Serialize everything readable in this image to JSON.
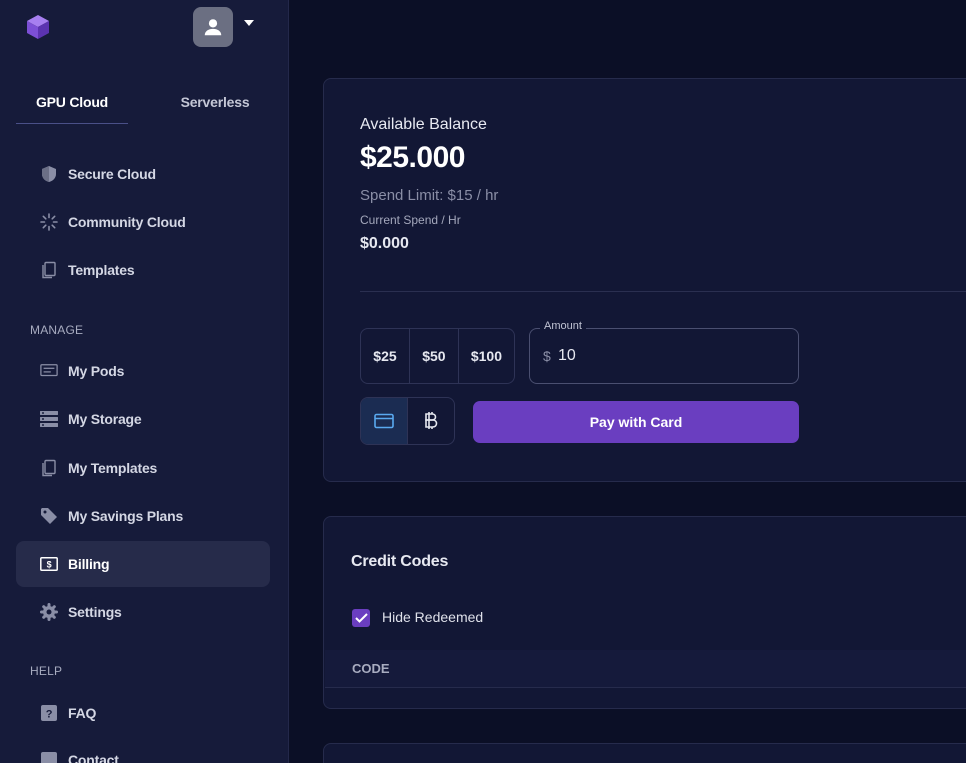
{
  "sidebar": {
    "tabs": [
      "GPU Cloud",
      "Serverless"
    ],
    "cloud_items": [
      "Secure Cloud",
      "Community Cloud",
      "Templates"
    ],
    "manage_title": "MANAGE",
    "manage_items": [
      "My Pods",
      "My Storage",
      "My Templates",
      "My Savings Plans",
      "Billing",
      "Settings"
    ],
    "help_title": "HELP",
    "help_items": [
      "FAQ",
      "Contact"
    ]
  },
  "balance": {
    "label": "Available Balance",
    "value": "$25.000",
    "spend_limit": "Spend Limit: $15 / hr",
    "current_label": "Current Spend / Hr",
    "current_value": "$0.000"
  },
  "payment": {
    "amount_options": [
      "$25",
      "$50",
      "$100"
    ],
    "amount_label": "Amount",
    "currency_prefix": "$",
    "amount_value": "10",
    "pay_button": "Pay with Card"
  },
  "credits": {
    "title": "Credit Codes",
    "hide_redeemed_label": "Hide Redeemed",
    "hide_redeemed_checked": true,
    "column_code": "CODE"
  },
  "colors": {
    "accent": "#6a3ec0",
    "sidebar_bg": "#161b3a",
    "page_bg": "#0b0f26"
  }
}
